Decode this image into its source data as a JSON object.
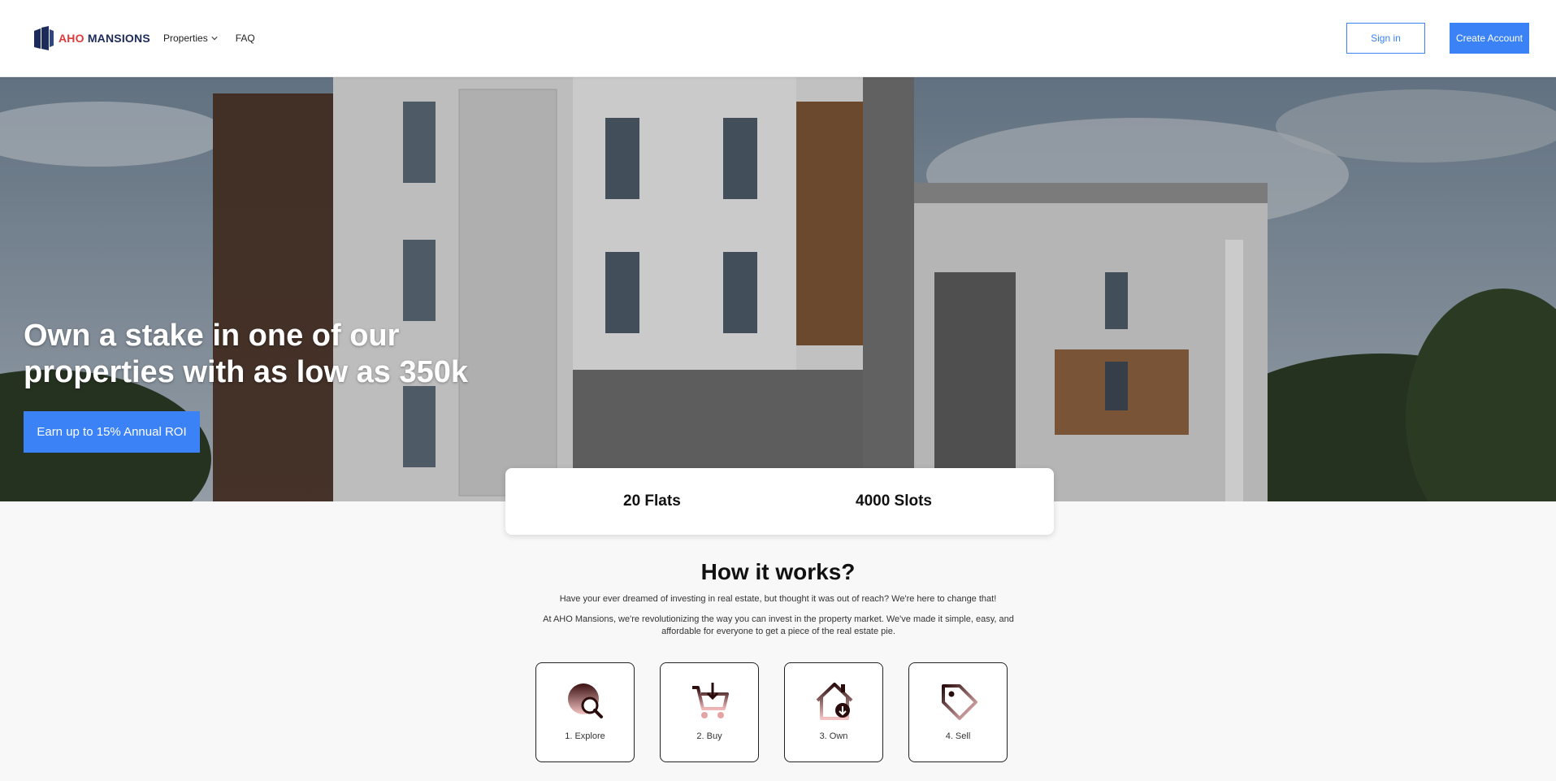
{
  "header": {
    "logo_aho": "AHO",
    "logo_mansions": "MANSIONS",
    "nav": {
      "properties": "Properties",
      "faq": "FAQ"
    },
    "sign_in": "Sign in",
    "create_account": "Create Account"
  },
  "hero": {
    "title": "Own a stake in one of our properties with as low as 350k",
    "cta": "Earn up to 15% Annual ROI"
  },
  "stats": {
    "flats": "20 Flats",
    "slots": "4000 Slots"
  },
  "how": {
    "title": "How it works?",
    "p1": "Have your ever dreamed of investing in real estate, but thought it was out of reach? We're here to change that!",
    "p2": "At AHO Mansions, we're revolutionizing the way you can invest in the property market. We've made it simple, easy, and affordable for everyone to get a piece of the real estate pie.",
    "steps": [
      {
        "label": "1. Explore",
        "icon": "explore-icon"
      },
      {
        "label": "2. Buy",
        "icon": "cart-icon"
      },
      {
        "label": "3. Own",
        "icon": "house-icon"
      },
      {
        "label": "4. Sell",
        "icon": "tag-icon"
      }
    ]
  },
  "colors": {
    "accent": "#3b82f6",
    "logo_red": "#e03b3b",
    "logo_navy": "#1c2b5a"
  }
}
